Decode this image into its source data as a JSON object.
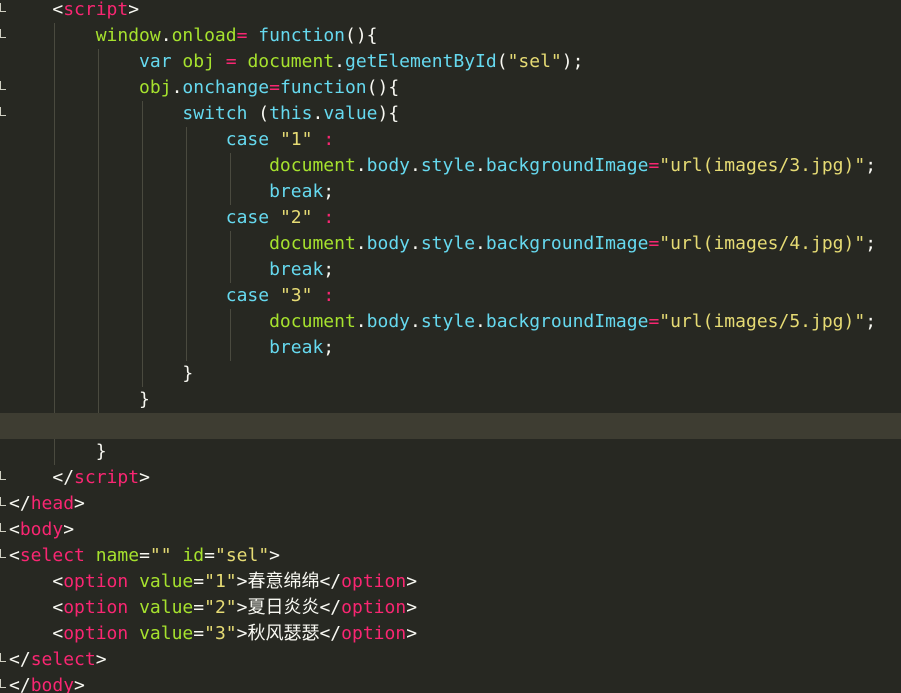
{
  "editor": {
    "lines": [
      {
        "tokens": [
          [
            "    ",
            "plain"
          ],
          [
            "<",
            "punc"
          ],
          [
            "script",
            "tag"
          ],
          [
            ">",
            "punc"
          ]
        ]
      },
      {
        "tokens": [
          [
            "        ",
            "plain"
          ],
          [
            "window",
            "obj"
          ],
          [
            ".",
            "punc"
          ],
          [
            "onload",
            "obj"
          ],
          [
            "=",
            "kw2"
          ],
          [
            " ",
            "plain"
          ],
          [
            "function",
            "fn"
          ],
          [
            "(){",
            "punc"
          ]
        ]
      },
      {
        "tokens": [
          [
            "            ",
            "plain"
          ],
          [
            "var",
            "kw"
          ],
          [
            " ",
            "plain"
          ],
          [
            "obj",
            "obj"
          ],
          [
            " ",
            "plain"
          ],
          [
            "=",
            "kw2"
          ],
          [
            " ",
            "plain"
          ],
          [
            "document",
            "obj"
          ],
          [
            ".",
            "punc"
          ],
          [
            "getElementById",
            "prop"
          ],
          [
            "(",
            "punc"
          ],
          [
            "\"sel\"",
            "str"
          ],
          [
            ");",
            "punc"
          ]
        ]
      },
      {
        "tokens": [
          [
            "            ",
            "plain"
          ],
          [
            "obj",
            "obj"
          ],
          [
            ".",
            "punc"
          ],
          [
            "onchange",
            "prop"
          ],
          [
            "=",
            "kw2"
          ],
          [
            "function",
            "fn"
          ],
          [
            "(){",
            "punc"
          ]
        ]
      },
      {
        "tokens": [
          [
            "                ",
            "plain"
          ],
          [
            "switch",
            "kw"
          ],
          [
            " (",
            "punc"
          ],
          [
            "this",
            "kw"
          ],
          [
            ".",
            "punc"
          ],
          [
            "value",
            "prop"
          ],
          [
            "){",
            "punc"
          ]
        ]
      },
      {
        "tokens": [
          [
            "                    ",
            "plain"
          ],
          [
            "case",
            "kw"
          ],
          [
            " ",
            "plain"
          ],
          [
            "\"1\"",
            "str"
          ],
          [
            " ",
            "plain"
          ],
          [
            ":",
            "kw2"
          ]
        ]
      },
      {
        "tokens": [
          [
            "                        ",
            "plain"
          ],
          [
            "document",
            "obj"
          ],
          [
            ".",
            "punc"
          ],
          [
            "body",
            "prop"
          ],
          [
            ".",
            "punc"
          ],
          [
            "style",
            "prop"
          ],
          [
            ".",
            "punc"
          ],
          [
            "backgroundImage",
            "prop"
          ],
          [
            "=",
            "kw2"
          ],
          [
            "\"url(images/3.jpg)\"",
            "str"
          ],
          [
            ";",
            "punc"
          ]
        ]
      },
      {
        "tokens": [
          [
            "                        ",
            "plain"
          ],
          [
            "break",
            "kw"
          ],
          [
            ";",
            "punc"
          ]
        ]
      },
      {
        "tokens": [
          [
            "                    ",
            "plain"
          ],
          [
            "case",
            "kw"
          ],
          [
            " ",
            "plain"
          ],
          [
            "\"2\"",
            "str"
          ],
          [
            " ",
            "plain"
          ],
          [
            ":",
            "kw2"
          ]
        ]
      },
      {
        "tokens": [
          [
            "                        ",
            "plain"
          ],
          [
            "document",
            "obj"
          ],
          [
            ".",
            "punc"
          ],
          [
            "body",
            "prop"
          ],
          [
            ".",
            "punc"
          ],
          [
            "style",
            "prop"
          ],
          [
            ".",
            "punc"
          ],
          [
            "backgroundImage",
            "prop"
          ],
          [
            "=",
            "kw2"
          ],
          [
            "\"url(images/4.jpg)\"",
            "str"
          ],
          [
            ";",
            "punc"
          ]
        ]
      },
      {
        "tokens": [
          [
            "                        ",
            "plain"
          ],
          [
            "break",
            "kw"
          ],
          [
            ";",
            "punc"
          ]
        ]
      },
      {
        "tokens": [
          [
            "                    ",
            "plain"
          ],
          [
            "case",
            "kw"
          ],
          [
            " ",
            "plain"
          ],
          [
            "\"3\"",
            "str"
          ],
          [
            " ",
            "plain"
          ],
          [
            ":",
            "kw2"
          ]
        ]
      },
      {
        "tokens": [
          [
            "                        ",
            "plain"
          ],
          [
            "document",
            "obj"
          ],
          [
            ".",
            "punc"
          ],
          [
            "body",
            "prop"
          ],
          [
            ".",
            "punc"
          ],
          [
            "style",
            "prop"
          ],
          [
            ".",
            "punc"
          ],
          [
            "backgroundImage",
            "prop"
          ],
          [
            "=",
            "kw2"
          ],
          [
            "\"url(images/5.jpg)\"",
            "str"
          ],
          [
            ";",
            "punc"
          ]
        ]
      },
      {
        "tokens": [
          [
            "                        ",
            "plain"
          ],
          [
            "break",
            "kw"
          ],
          [
            ";",
            "punc"
          ]
        ]
      },
      {
        "tokens": [
          [
            "                ",
            "plain"
          ],
          [
            "}",
            "punc"
          ]
        ]
      },
      {
        "tokens": [
          [
            "            ",
            "plain"
          ],
          [
            "}",
            "punc"
          ]
        ]
      },
      {
        "tokens": [],
        "current": true
      },
      {
        "tokens": [
          [
            "        ",
            "plain"
          ],
          [
            "}",
            "punc"
          ]
        ]
      },
      {
        "tokens": [
          [
            "    ",
            "plain"
          ],
          [
            "</",
            "punc"
          ],
          [
            "script",
            "tag"
          ],
          [
            ">",
            "punc"
          ]
        ]
      },
      {
        "tokens": [
          [
            "</",
            "punc"
          ],
          [
            "head",
            "tag"
          ],
          [
            ">",
            "punc"
          ]
        ]
      },
      {
        "tokens": [
          [
            "<",
            "punc"
          ],
          [
            "body",
            "tag"
          ],
          [
            ">",
            "punc"
          ]
        ]
      },
      {
        "tokens": [
          [
            "<",
            "punc"
          ],
          [
            "select",
            "tag"
          ],
          [
            " ",
            "plain"
          ],
          [
            "name",
            "attr"
          ],
          [
            "=",
            "punc"
          ],
          [
            "\"\"",
            "str"
          ],
          [
            " ",
            "plain"
          ],
          [
            "id",
            "attr"
          ],
          [
            "=",
            "punc"
          ],
          [
            "\"sel\"",
            "str"
          ],
          [
            ">",
            "punc"
          ]
        ]
      },
      {
        "tokens": [
          [
            "    ",
            "plain"
          ],
          [
            "<",
            "punc"
          ],
          [
            "option",
            "tag"
          ],
          [
            " ",
            "plain"
          ],
          [
            "value",
            "attr"
          ],
          [
            "=",
            "punc"
          ],
          [
            "\"1\"",
            "str"
          ],
          [
            ">",
            "punc"
          ],
          [
            "春意绵绵",
            "text"
          ],
          [
            "</",
            "punc"
          ],
          [
            "option",
            "tag"
          ],
          [
            ">",
            "punc"
          ]
        ]
      },
      {
        "tokens": [
          [
            "    ",
            "plain"
          ],
          [
            "<",
            "punc"
          ],
          [
            "option",
            "tag"
          ],
          [
            " ",
            "plain"
          ],
          [
            "value",
            "attr"
          ],
          [
            "=",
            "punc"
          ],
          [
            "\"2\"",
            "str"
          ],
          [
            ">",
            "punc"
          ],
          [
            "夏日炎炎",
            "text"
          ],
          [
            "</",
            "punc"
          ],
          [
            "option",
            "tag"
          ],
          [
            ">",
            "punc"
          ]
        ]
      },
      {
        "tokens": [
          [
            "    ",
            "plain"
          ],
          [
            "<",
            "punc"
          ],
          [
            "option",
            "tag"
          ],
          [
            " ",
            "plain"
          ],
          [
            "value",
            "attr"
          ],
          [
            "=",
            "punc"
          ],
          [
            "\"3\"",
            "str"
          ],
          [
            ">",
            "punc"
          ],
          [
            "秋风瑟瑟",
            "text"
          ],
          [
            "</",
            "punc"
          ],
          [
            "option",
            "tag"
          ],
          [
            ">",
            "punc"
          ]
        ]
      },
      {
        "tokens": [
          [
            "</",
            "punc"
          ],
          [
            "select",
            "tag"
          ],
          [
            ">",
            "punc"
          ]
        ]
      },
      {
        "tokens": [
          [
            "</",
            "punc"
          ],
          [
            "body",
            "tag"
          ],
          [
            ">",
            "punc"
          ]
        ]
      }
    ]
  },
  "colors": {
    "background": "#272822",
    "current_line": "#3e3d32",
    "tag": "#f92672",
    "attribute": "#a6e22e",
    "string": "#e6db74",
    "keyword": "#66d9ef",
    "text": "#f8f8f2"
  },
  "icons": [
    "fold-marker-icon"
  ]
}
